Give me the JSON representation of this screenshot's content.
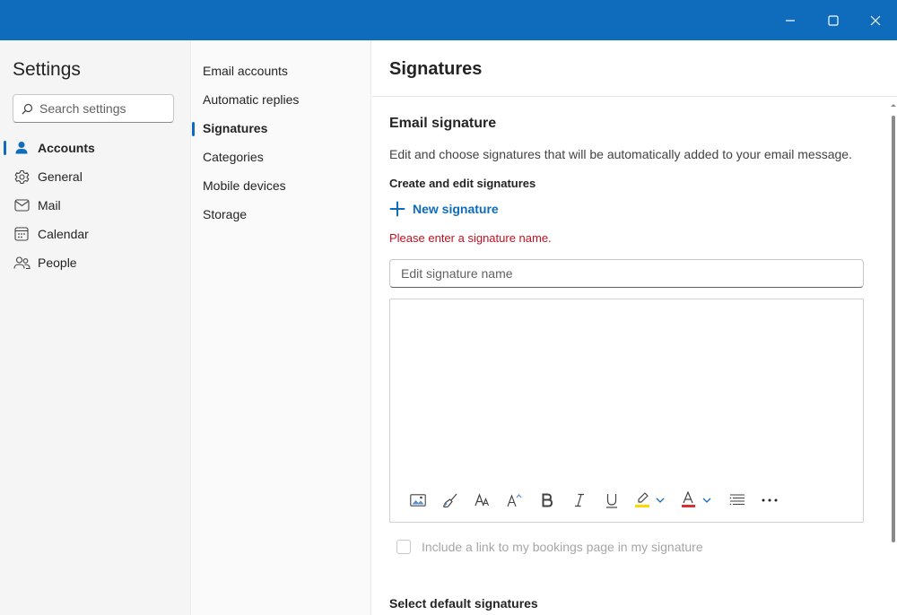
{
  "window": {
    "minimize_icon": "minimize-icon",
    "maximize_icon": "maximize-icon",
    "close_icon": "close-icon",
    "titlebar_color": "#0f6cbd"
  },
  "settings": {
    "title": "Settings",
    "search_placeholder": "Search settings"
  },
  "nav": [
    {
      "label": "Accounts",
      "icon": "person-icon",
      "active": true
    },
    {
      "label": "General",
      "icon": "gear-icon",
      "active": false
    },
    {
      "label": "Mail",
      "icon": "mail-icon",
      "active": false
    },
    {
      "label": "Calendar",
      "icon": "calendar-icon",
      "active": false
    },
    {
      "label": "People",
      "icon": "people-icon",
      "active": false
    }
  ],
  "subnav": [
    {
      "label": "Email accounts",
      "active": false
    },
    {
      "label": "Automatic replies",
      "active": false
    },
    {
      "label": "Signatures",
      "active": true
    },
    {
      "label": "Categories",
      "active": false
    },
    {
      "label": "Mobile devices",
      "active": false
    },
    {
      "label": "Storage",
      "active": false
    }
  ],
  "main": {
    "title": "Signatures",
    "section_title": "Email signature",
    "description": "Edit and choose signatures that will be automatically added to your email message.",
    "create_title": "Create and edit signatures",
    "new_signature_label": "New signature",
    "error": "Please enter a signature name.",
    "name_placeholder": "Edit signature name",
    "name_value": "",
    "toolbar": [
      "insert-picture-icon",
      "format-painter-icon",
      "font-size-icon",
      "grow-font-icon",
      "bold-icon",
      "italic-icon",
      "underline-icon",
      "highlight-icon",
      "font-color-icon",
      "bullets-icon",
      "more-options-icon"
    ],
    "bookings_checkbox": {
      "label": "Include a link to my bookings page in my signature",
      "checked": false
    },
    "default_title": "Select default signatures"
  },
  "colors": {
    "accent": "#0f6cbd",
    "error": "#c50f1f",
    "highlight": "#ffd800",
    "font_color": "#d13438"
  }
}
